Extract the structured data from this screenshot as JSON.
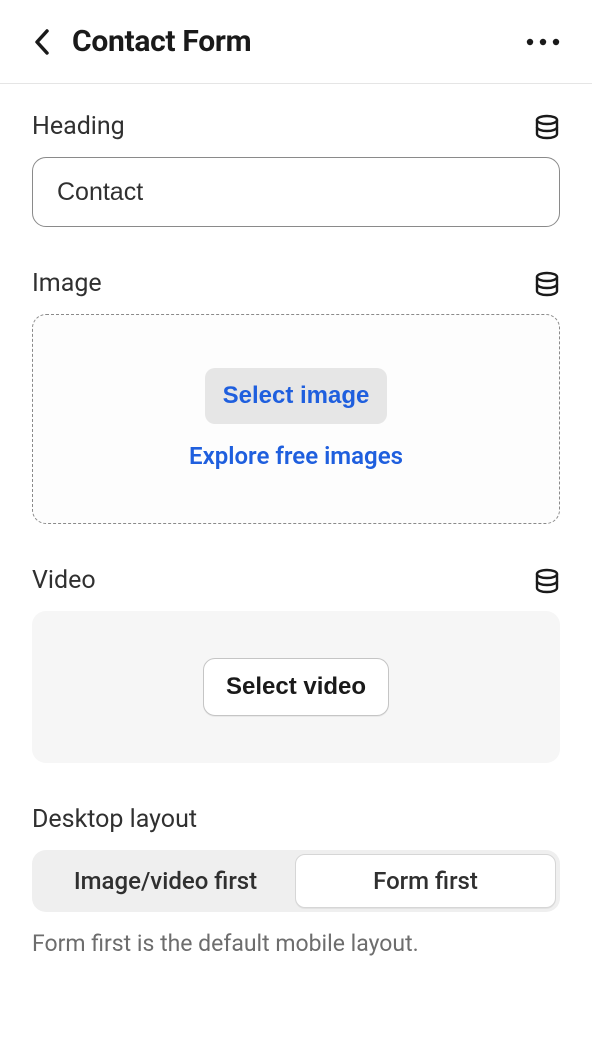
{
  "header": {
    "title": "Contact Form"
  },
  "fields": {
    "heading": {
      "label": "Heading",
      "value": "Contact"
    },
    "image": {
      "label": "Image",
      "select_button": "Select image",
      "explore_link": "Explore free images"
    },
    "video": {
      "label": "Video",
      "select_button": "Select video"
    },
    "desktop_layout": {
      "label": "Desktop layout",
      "option1": "Image/video first",
      "option2": "Form first",
      "help": "Form first is the default mobile layout."
    }
  }
}
